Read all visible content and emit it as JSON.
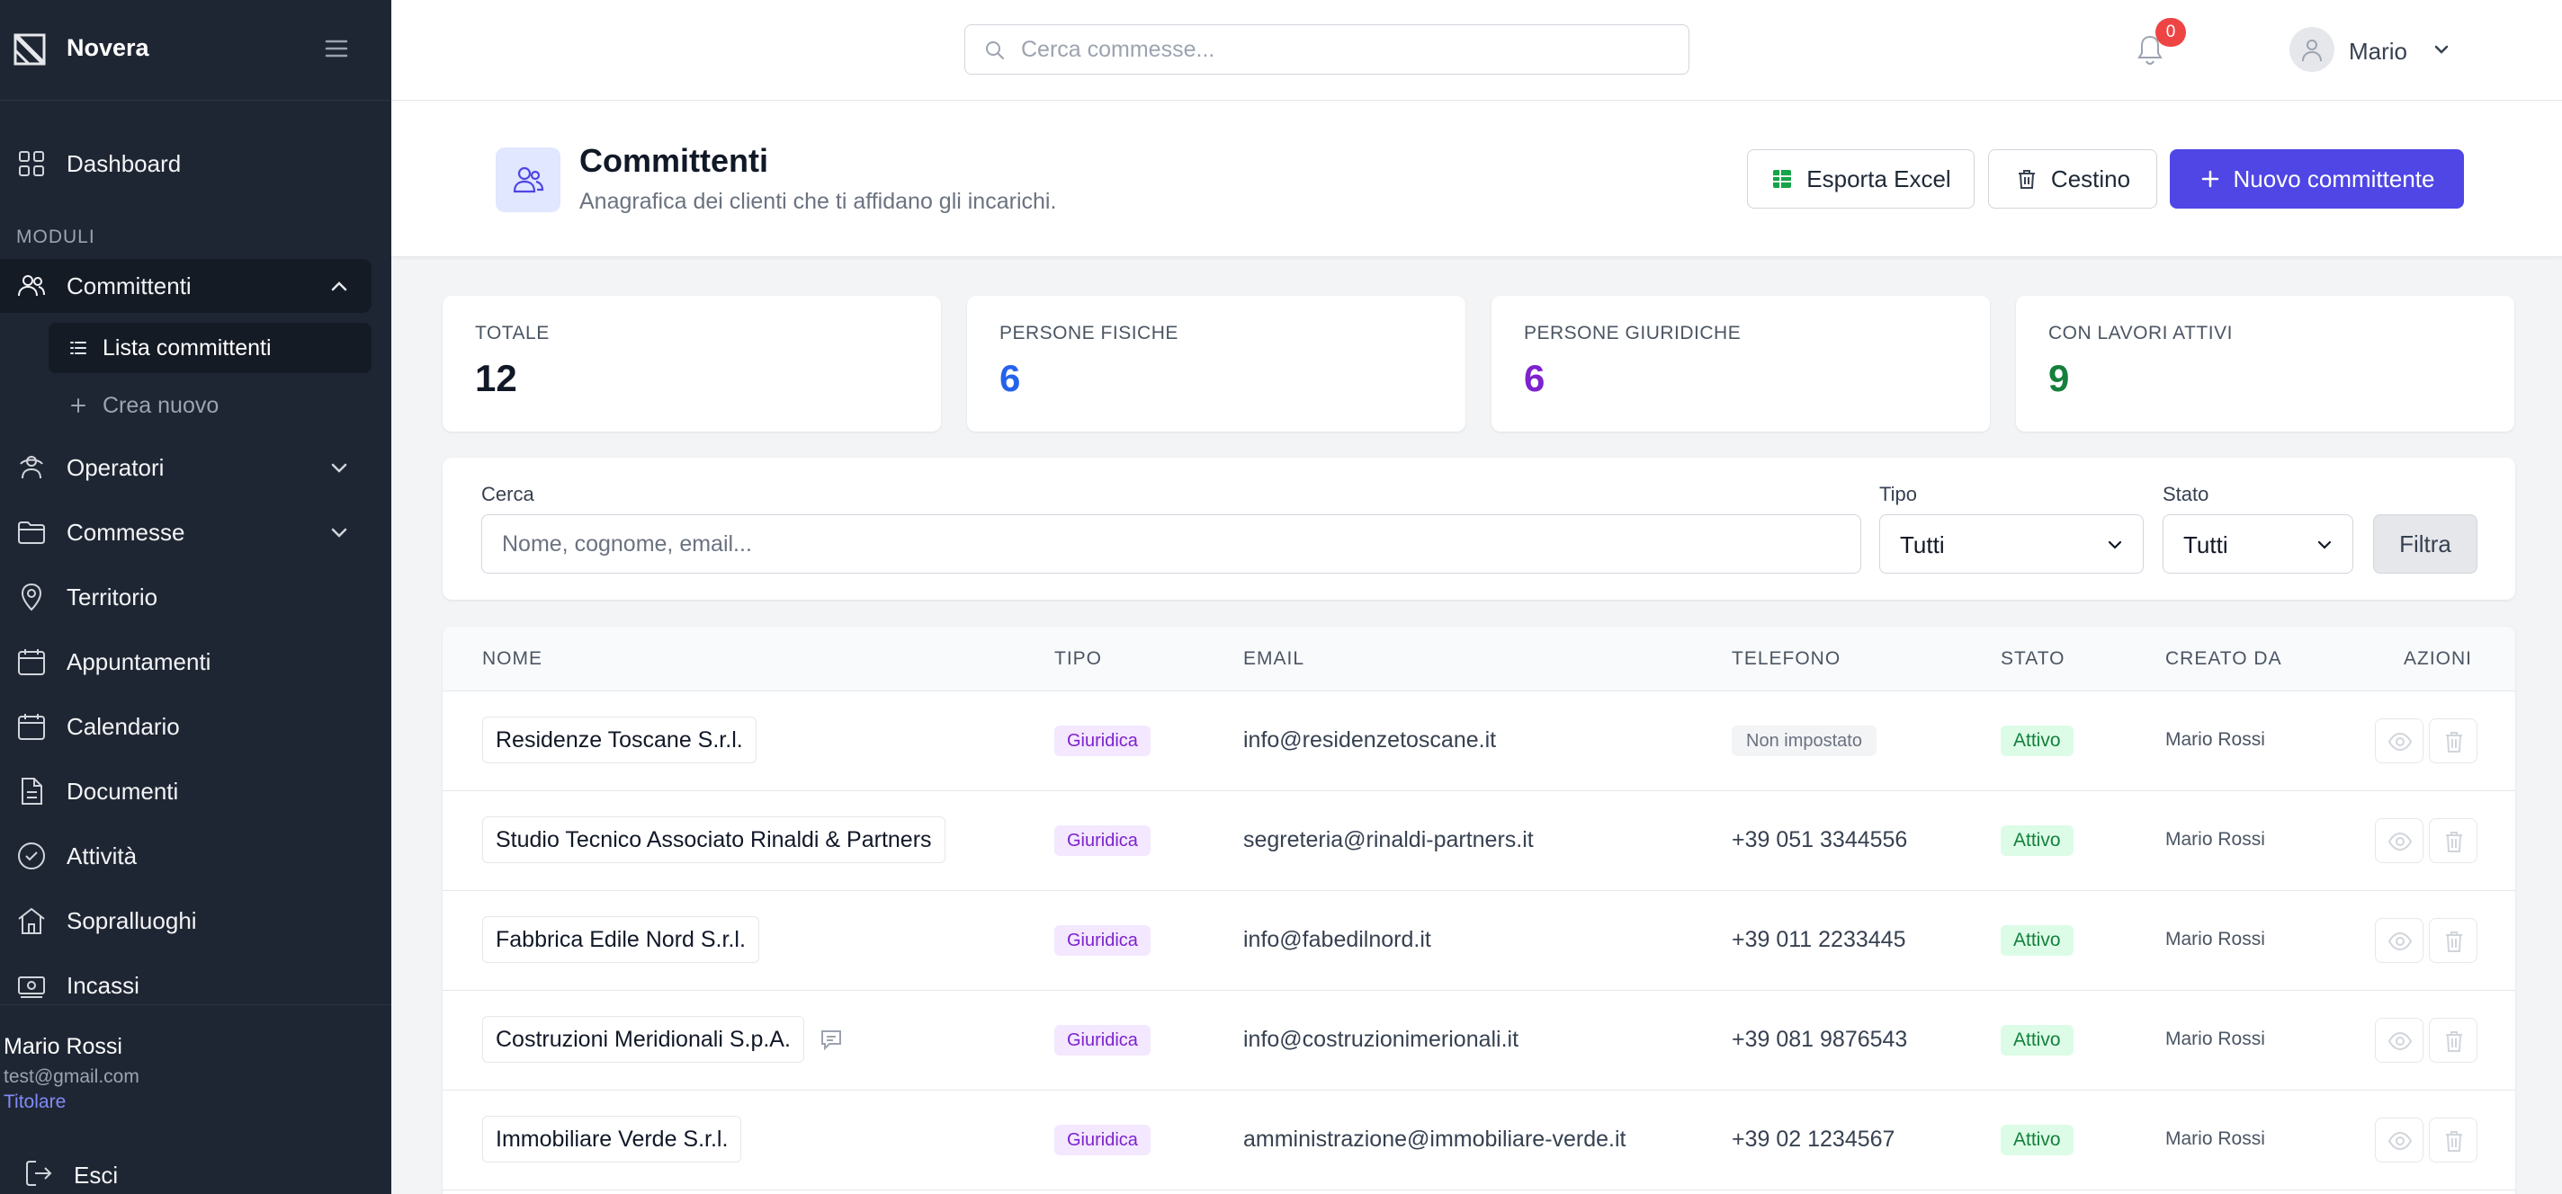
{
  "app": {
    "name": "Novera"
  },
  "sidebar": {
    "dashboard": "Dashboard",
    "section_label": "MODULI",
    "committenti": "Committenti",
    "sub_items": [
      "Lista committenti",
      "Crea nuovo"
    ],
    "items": [
      "Operatori",
      "Commesse",
      "Territorio",
      "Appuntamenti",
      "Calendario",
      "Documenti",
      "Attività",
      "Sopralluoghi",
      "Incassi"
    ],
    "user": {
      "name": "Mario Rossi",
      "email": "test@gmail.com",
      "role": "Titolare"
    },
    "logout": "Esci"
  },
  "topbar": {
    "search_placeholder": "Cerca commesse...",
    "notification_count": "0",
    "user_name": "Mario"
  },
  "header": {
    "title": "Committenti",
    "subtitle": "Anagrafica dei clienti che ti affidano gli incarichi.",
    "export_label": "Esporta Excel",
    "trash_label": "Cestino",
    "new_label": "Nuovo committente"
  },
  "stats": [
    {
      "label": "TOTALE",
      "value": "12",
      "color": "#111827"
    },
    {
      "label": "PERSONE FISICHE",
      "value": "6",
      "color": "#2563eb"
    },
    {
      "label": "PERSONE GIURIDICHE",
      "value": "6",
      "color": "#7e22ce"
    },
    {
      "label": "CON LAVORI ATTIVI",
      "value": "9",
      "color": "#15803d"
    }
  ],
  "filters": {
    "search_label": "Cerca",
    "search_placeholder": "Nome, cognome, email...",
    "tipo_label": "Tipo",
    "tipo_value": "Tutti",
    "stato_label": "Stato",
    "stato_value": "Tutti",
    "button_label": "Filtra"
  },
  "table": {
    "headers": [
      "NOME",
      "TIPO",
      "EMAIL",
      "TELEFONO",
      "STATO",
      "CREATO DA",
      "AZIONI"
    ],
    "rows": [
      {
        "nome": "Residenze Toscane S.r.l.",
        "tipo": "Giuridica",
        "email": "info@residenzetoscane.it",
        "telefono": "Non impostato",
        "stato": "Attivo",
        "creato_da": "Mario Rossi"
      },
      {
        "nome": "Studio Tecnico Associato Rinaldi & Partners",
        "tipo": "Giuridica",
        "email": "segreteria@rinaldi-partners.it",
        "telefono": "+39 051 3344556",
        "stato": "Attivo",
        "creato_da": "Mario Rossi"
      },
      {
        "nome": "Fabbrica Edile Nord S.r.l.",
        "tipo": "Giuridica",
        "email": "info@fabedilnord.it",
        "telefono": "+39 011 2233445",
        "stato": "Attivo",
        "creato_da": "Mario Rossi"
      },
      {
        "nome": "Costruzioni Meridionali S.p.A.",
        "tipo": "Giuridica",
        "email": "info@costruzionimerionali.it",
        "telefono": "+39 081 9876543",
        "stato": "Attivo",
        "creato_da": "Mario Rossi"
      },
      {
        "nome": "Immobiliare Verde S.r.l.",
        "tipo": "Giuridica",
        "email": "amministrazione@immobiliare-verde.it",
        "telefono": "+39 02 1234567",
        "stato": "Attivo",
        "creato_da": "Mario Rossi"
      }
    ]
  }
}
